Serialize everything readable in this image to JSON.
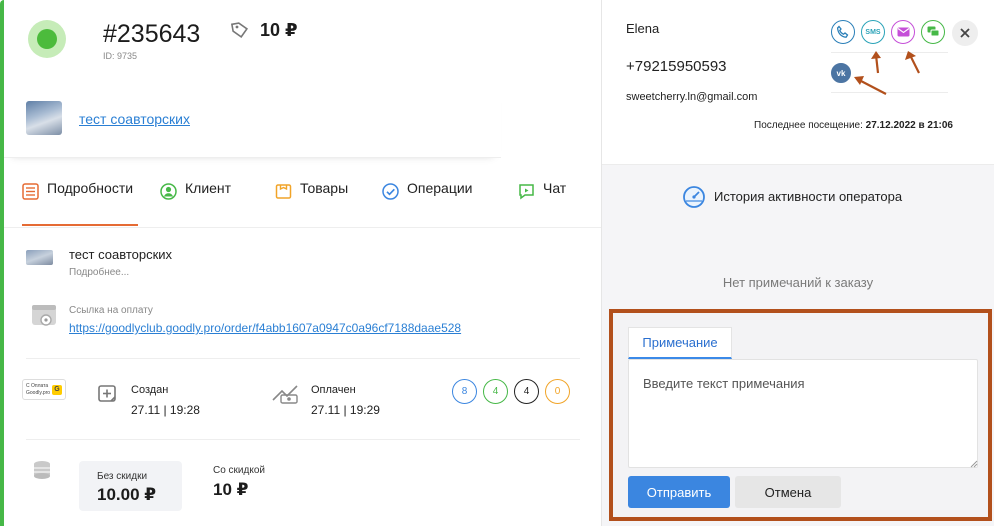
{
  "order": {
    "number": "#235643",
    "id_line": "ID: 9735",
    "price": "10 ₽",
    "tag_icon": "tag-icon",
    "status_color": "#4cbb3c"
  },
  "product": {
    "name": "тест соавторских"
  },
  "tabs": [
    {
      "label": "Подробности",
      "icon": "list-icon",
      "color": "#e56b34",
      "active": true
    },
    {
      "label": "Клиент",
      "icon": "user-icon",
      "color": "#46b847"
    },
    {
      "label": "Товары",
      "icon": "box-icon",
      "color": "#f1a428"
    },
    {
      "label": "Операции",
      "icon": "check-icon",
      "color": "#3b86e0"
    },
    {
      "label": "Чат",
      "icon": "chat-icon",
      "color": "#46b847"
    }
  ],
  "details": {
    "title": "тест соавторских",
    "more": "Подробнее...",
    "pay_label": "Ссылка на оплату",
    "pay_link": "https://goodlyclub.goodly.pro/order/f4abb1607a0947c0a96cf7188daae528",
    "badge_line1": "С Оплата",
    "badge_line2": "Goodly.pro",
    "badge_mark": "G",
    "created_label": "Создан",
    "created_value": "27.11 | 19:28",
    "paid_label": "Оплачен",
    "paid_value": "27.11 | 19:29",
    "counters": [
      {
        "value": "8",
        "color": "#3b86e0"
      },
      {
        "value": "4",
        "color": "#46b847"
      },
      {
        "value": "4",
        "color": "#222222"
      },
      {
        "value": "0",
        "color": "#f1a428"
      }
    ],
    "no_discount_label": "Без скидки",
    "no_discount_value": "10.00 ₽",
    "discount_label": "Со скидкой",
    "discount_value": "10 ₽"
  },
  "client": {
    "name": "Elena",
    "phone": "+79215950593",
    "email": "sweetcherry.ln@gmail.com",
    "visit_label": "Последнее посещение:",
    "visit_value": "27.12.2022 в 21:06",
    "contact_icons": [
      {
        "icon": "phone-icon",
        "color": "#2a7fb8"
      },
      {
        "icon": "sms-icon",
        "label": "SMS",
        "color": "#2aa3b8"
      },
      {
        "icon": "mail-icon",
        "color": "#c54fd8"
      },
      {
        "icon": "chat-icon",
        "color": "#46b847"
      },
      {
        "icon": "vk-icon",
        "label": "vk",
        "color": "#4c75a3"
      }
    ]
  },
  "activity": {
    "title": "История активности оператора",
    "empty": "Нет примечаний к заказу"
  },
  "note": {
    "tab_label": "Примечание",
    "placeholder": "Введите текст примечания",
    "send_label": "Отправить",
    "cancel_label": "Отмена",
    "frame_color": "#b2501c"
  }
}
